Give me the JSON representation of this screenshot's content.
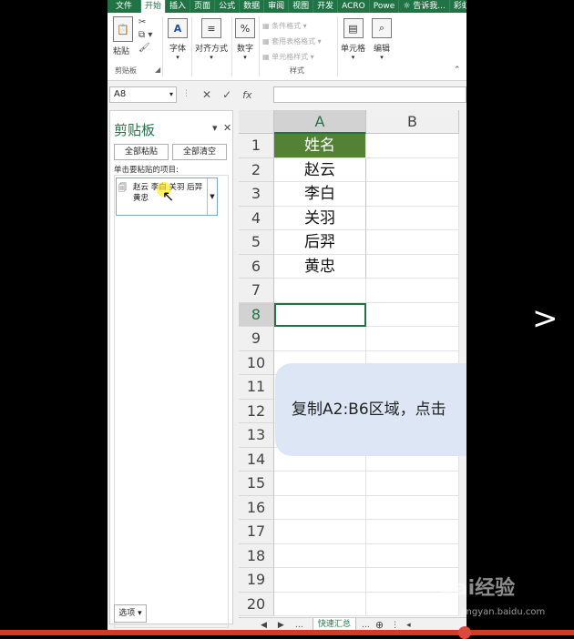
{
  "tabs": [
    "文件",
    "开始",
    "插入",
    "页面",
    "公式",
    "数据",
    "审阅",
    "视图",
    "开发",
    "ACRO",
    "Powe"
  ],
  "tell_me": "告诉我...",
  "user": "彩虹",
  "ribbon": {
    "clipboard": {
      "paste": "粘贴",
      "group_label": "剪贴板"
    },
    "font": {
      "label": "字体"
    },
    "alignment": {
      "label": "对齐方式"
    },
    "number": {
      "label": "数字"
    },
    "styles": {
      "conditional": "条件格式",
      "table": "套用表格格式",
      "cell_styles": "单元格样式",
      "group_label": "样式"
    },
    "cells": {
      "label": "单元格"
    },
    "editing": {
      "label": "编辑"
    }
  },
  "formula_bar": {
    "name_box": "A8",
    "fx": "fx"
  },
  "clipboard_pane": {
    "title": "剪贴板",
    "paste_all": "全部粘贴",
    "clear_all": "全部清空",
    "hint": "单击要粘贴的项目:",
    "item_text": "赵云 李白 关羽 后羿 黄忠",
    "options": "选项"
  },
  "columns": [
    "A",
    "B"
  ],
  "rows": [
    "1",
    "2",
    "3",
    "4",
    "5",
    "6",
    "7",
    "8",
    "9",
    "10",
    "11",
    "12",
    "13",
    "14",
    "15",
    "16",
    "17",
    "18",
    "19",
    "20"
  ],
  "cells": [
    "姓名",
    "赵云",
    "李白",
    "关羽",
    "后羿",
    "黄忠"
  ],
  "callout": "复制A2:B6区域，点击",
  "sheet_tab": "快速汇总",
  "watermark": {
    "brand": "Bai经验",
    "url": "jingyan.baidu.com"
  },
  "colors": {
    "excel_green": "#217346",
    "header_fill": "#548235",
    "callout_bg": "#dde6f4"
  }
}
